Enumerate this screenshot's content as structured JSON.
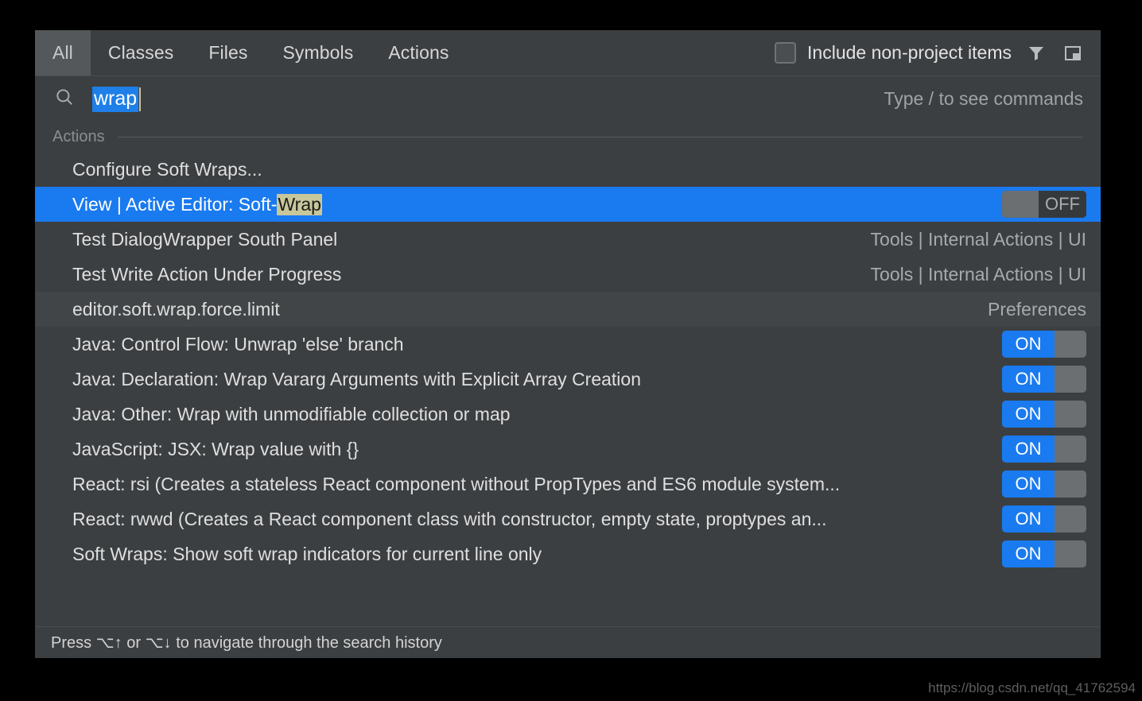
{
  "colors": {
    "popup_bg": "#3c3f41",
    "selected_row": "#1a7aef",
    "accent_blue": "#1e7fe8",
    "match_highlight": "#c8c79a",
    "alt_row": "#414547",
    "outside": "#000000"
  },
  "tabs": [
    {
      "label": "All",
      "selected": true
    },
    {
      "label": "Classes",
      "selected": false
    },
    {
      "label": "Files",
      "selected": false
    },
    {
      "label": "Symbols",
      "selected": false
    },
    {
      "label": "Actions",
      "selected": false
    }
  ],
  "header": {
    "include_non_project_label": "Include non-project items",
    "include_non_project_checked": false,
    "filter_icon": "filter-funnel-icon",
    "panel_icon": "toggle-preview-panel-icon"
  },
  "search": {
    "icon": "search-icon",
    "value": "wrap",
    "selected": true,
    "placeholder": "Type / to see commands",
    "hint": "Type / to see commands"
  },
  "groups": [
    {
      "label": "Actions"
    }
  ],
  "rows": [
    {
      "title_pre": "Configure Soft Wraps...",
      "title_hl": "",
      "title_post": "",
      "group_path": "",
      "toggle": "",
      "selected": false,
      "alt": false
    },
    {
      "title_pre": "View | Active Editor: Soft-",
      "title_hl": "Wrap",
      "title_post": "",
      "group_path": "",
      "toggle": "OFF",
      "selected": true,
      "alt": false
    },
    {
      "title_pre": "Test DialogWrapper South Panel",
      "title_hl": "",
      "title_post": "",
      "group_path": "Tools | Internal Actions | UI",
      "toggle": "",
      "selected": false,
      "alt": false
    },
    {
      "title_pre": "Test Write Action Under Progress",
      "title_hl": "",
      "title_post": "",
      "group_path": "Tools | Internal Actions | UI",
      "toggle": "",
      "selected": false,
      "alt": false
    },
    {
      "title_pre": "editor.soft.wrap.force.limit",
      "title_hl": "",
      "title_post": "",
      "group_path": "Preferences",
      "toggle": "",
      "selected": false,
      "alt": true
    },
    {
      "title_pre": "Java: Control Flow: Unwrap 'else' branch",
      "title_hl": "",
      "title_post": "",
      "group_path": "",
      "toggle": "ON",
      "selected": false,
      "alt": false
    },
    {
      "title_pre": "Java: Declaration: Wrap Vararg Arguments with Explicit Array Creation",
      "title_hl": "",
      "title_post": "",
      "group_path": "",
      "toggle": "ON",
      "selected": false,
      "alt": false
    },
    {
      "title_pre": "Java: Other: Wrap with unmodifiable collection or map",
      "title_hl": "",
      "title_post": "",
      "group_path": "",
      "toggle": "ON",
      "selected": false,
      "alt": false
    },
    {
      "title_pre": "JavaScript: JSX: Wrap value with {}",
      "title_hl": "",
      "title_post": "",
      "group_path": "",
      "toggle": "ON",
      "selected": false,
      "alt": false
    },
    {
      "title_pre": "React: rsi (Creates a stateless React component without PropTypes and ES6 module system...",
      "title_hl": "",
      "title_post": "",
      "group_path": "",
      "toggle": "ON",
      "selected": false,
      "alt": false
    },
    {
      "title_pre": "React: rwwd (Creates a React component class with constructor, empty state, proptypes an...",
      "title_hl": "",
      "title_post": "",
      "group_path": "",
      "toggle": "ON",
      "selected": false,
      "alt": false
    },
    {
      "title_pre": "Soft Wraps: Show soft wrap indicators for current line only",
      "title_hl": "",
      "title_post": "",
      "group_path": "",
      "toggle": "ON",
      "selected": false,
      "alt": false
    }
  ],
  "footer": {
    "hint": "Press ⌥↑ or ⌥↓ to navigate through the search history"
  },
  "watermark": {
    "text": "https://blog.csdn.net/qq_41762594"
  }
}
